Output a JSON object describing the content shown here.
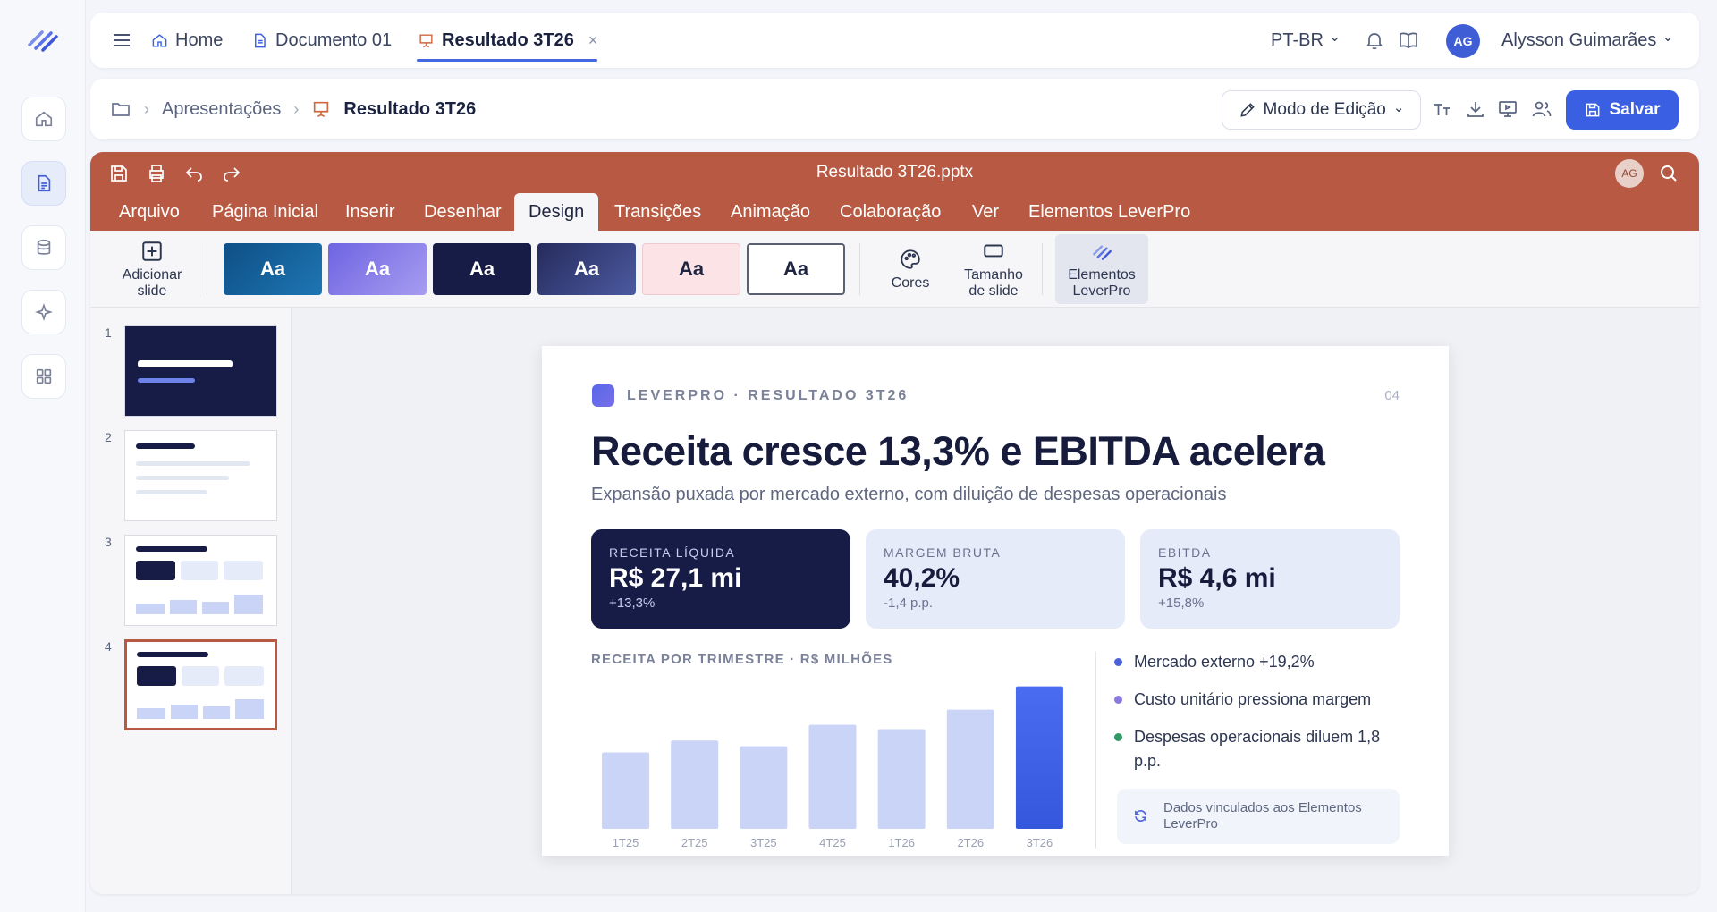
{
  "topbar": {
    "tabs": [
      {
        "label": "Home"
      },
      {
        "label": "Documento 01"
      },
      {
        "label": "Resultado 3T26",
        "close": "×"
      }
    ],
    "language": "PT-BR",
    "avatar_initials": "AG",
    "user_name": "Alysson Guimarães",
    "chevron": "⌄"
  },
  "breadcrumb": {
    "items": [
      "Apresentações",
      "Resultado 3T26"
    ],
    "separator": "›",
    "mode_label": "Modo de Edição",
    "save_label": "Salvar"
  },
  "editor": {
    "file_name": "Resultado 3T26.pptx",
    "avatar_initials": "AG",
    "menu": [
      "Arquivo",
      "Página Inicial",
      "Inserir",
      "Desenhar",
      "Design",
      "Transições",
      "Animação",
      "Colaboração",
      "Ver",
      "Elementos LeverPro"
    ],
    "active_menu": "Design",
    "ribbon": {
      "add_slide": [
        "Adicionar",
        "slide"
      ],
      "theme_label": "Aa",
      "colors": "Cores",
      "slide_size": [
        "Tamanho",
        "de slide"
      ],
      "lever_elements": [
        "Elementos",
        "LeverPro"
      ]
    },
    "slides": [
      "1",
      "2",
      "3",
      "4"
    ],
    "selected_slide": 4
  },
  "slide": {
    "kicker": "LEVERPRO · RESULTADO 3T26",
    "page": "04",
    "title": "Receita cresce 13,3% e EBITDA acelera",
    "subtitle": "Expansão puxada por mercado externo, com diluição de despesas operacionais",
    "kpis": [
      {
        "label": "RECEITA LÍQUIDA",
        "value": "R$ 27,1 mi",
        "delta": "+13,3%"
      },
      {
        "label": "MARGEM BRUTA",
        "value": "40,2%",
        "delta": "-1,4 p.p."
      },
      {
        "label": "EBITDA",
        "value": "R$ 4,6 mi",
        "delta": "+15,8%"
      }
    ],
    "bullets": [
      {
        "text": "Mercado externo +19,2%",
        "color": "#4b62d9"
      },
      {
        "text": "Custo unitário pressiona margem",
        "color": "#8a7ae0"
      },
      {
        "text": "Despesas operacionais diluem 1,8 p.p.",
        "color": "#2f9a66"
      }
    ],
    "linked_note": "Dados vinculados aos Elementos LeverPro"
  },
  "chart_data": {
    "type": "bar",
    "title": "RECEITA POR TRIMESTRE · R$ MILHÕES",
    "categories": [
      "1T25",
      "2T25",
      "3T25",
      "4T25",
      "1T26",
      "2T26",
      "3T26"
    ],
    "values": [
      16.1,
      18.6,
      17.4,
      21.9,
      21.0,
      25.1,
      30.0
    ],
    "ylim": [
      0,
      32
    ],
    "highlight_index": 6,
    "colors": {
      "bar": "#c9d4f7",
      "highlight": "#3457dc"
    }
  }
}
